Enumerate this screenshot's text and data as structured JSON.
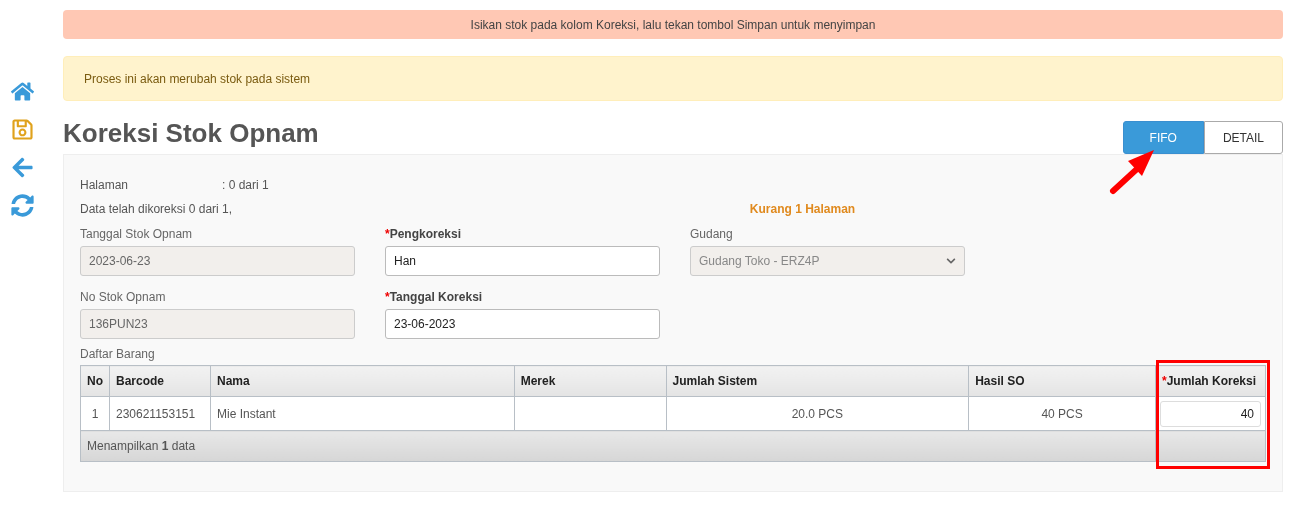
{
  "sidebar": {
    "items": [
      {
        "kind": "home"
      },
      {
        "kind": "save"
      },
      {
        "kind": "back"
      },
      {
        "kind": "refresh"
      }
    ]
  },
  "notice": "Isikan stok pada kolom Koreksi, lalu tekan tombol Simpan untuk menyimpan",
  "alert": "Proses ini akan merubah stok pada sistem",
  "title": "Koreksi Stok Opnam",
  "tabs": [
    {
      "label": "FIFO",
      "selected": true,
      "pointed": true
    },
    {
      "label": "DETAIL",
      "selected": false,
      "pointed": false
    }
  ],
  "info": {
    "page_label": "Halaman",
    "page_value": ": 0 dari 1",
    "progress": "Data telah dikoreksi 0 dari 1,",
    "warning": "Kurang 1 Halaman"
  },
  "form": {
    "columns": [
      [
        {
          "label": "Tanggal Stok Opnam",
          "required": false,
          "value": "2023-06-23",
          "kind": "readonly"
        },
        {
          "label": "No Stok Opnam",
          "required": false,
          "value": "136PUN23",
          "kind": "readonly"
        }
      ],
      [
        {
          "label": "Pengkoreksi",
          "required": true,
          "value": "Han",
          "kind": "input"
        },
        {
          "label": "Tanggal Koreksi",
          "required": true,
          "value": "23-06-2023",
          "kind": "input"
        }
      ],
      [
        {
          "label": "Gudang",
          "required": false,
          "value": "Gudang Toko - ERZ4P",
          "kind": "select",
          "disabled": true
        }
      ]
    ]
  },
  "required_mark": "*",
  "table": {
    "caption": "Daftar Barang",
    "columns": [
      {
        "label": "No",
        "required": false
      },
      {
        "label": "Barcode",
        "required": false
      },
      {
        "label": "Nama",
        "required": false
      },
      {
        "label": "Merek",
        "required": false
      },
      {
        "label": "Jumlah Sistem",
        "required": false
      },
      {
        "label": "Hasil SO",
        "required": false
      },
      {
        "label": "Jumlah Koreksi",
        "required": true,
        "highlighted": true
      }
    ],
    "rows": [
      {
        "no": "1",
        "barcode": "230621153151",
        "nama": "Mie Instant",
        "merek": "",
        "jumlah_sistem": "20.0 PCS",
        "hasil_so": "40 PCS",
        "jumlah_koreksi": "40"
      }
    ],
    "footer": "Menampilkan **1** data"
  }
}
